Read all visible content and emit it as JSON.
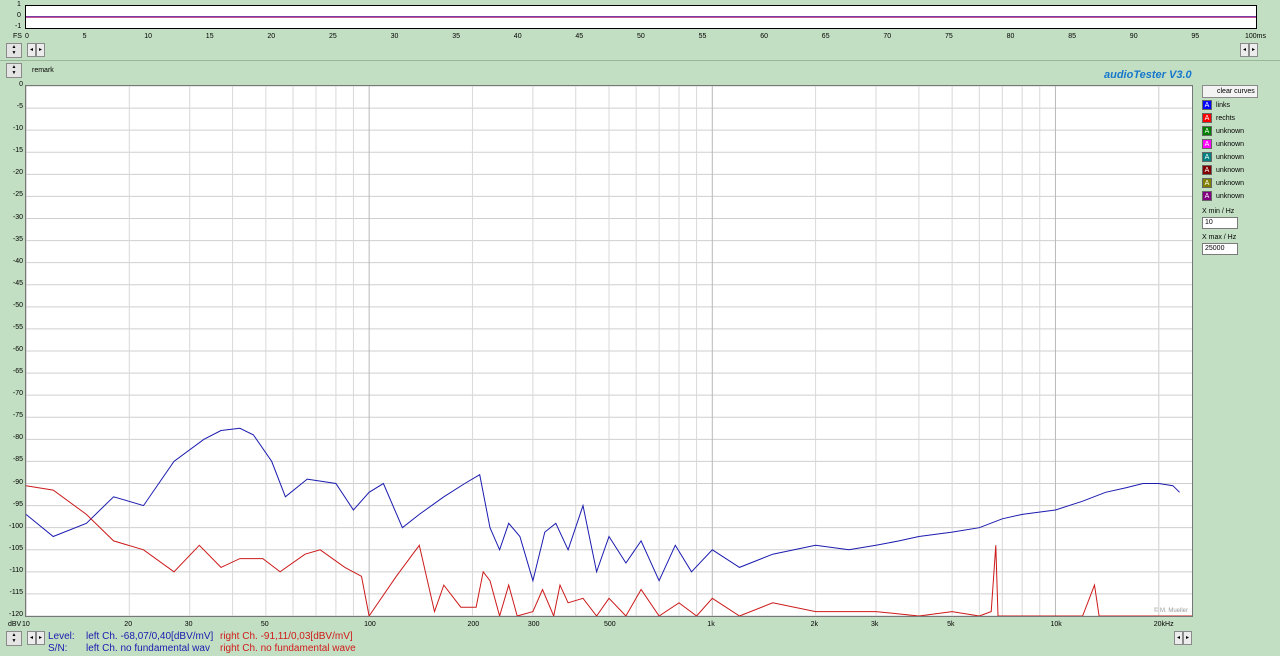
{
  "oscilloscope": {
    "y_labels": [
      "1",
      "0",
      "-1"
    ],
    "fs_label": "FS",
    "x_ticks": [
      "0",
      "5",
      "10",
      "15",
      "20",
      "25",
      "30",
      "35",
      "40",
      "45",
      "50",
      "55",
      "60",
      "65",
      "70",
      "75",
      "80",
      "85",
      "90",
      "95",
      "100ms"
    ]
  },
  "remark": {
    "label": "remark"
  },
  "brand": {
    "title": "audioTester  V3.0"
  },
  "copyright": "© M. Mueller",
  "spectrum": {
    "unit_label": "dBV",
    "y_ticks": [
      "0",
      "-5",
      "-10",
      "-15",
      "-20",
      "-25",
      "-30",
      "-35",
      "-40",
      "-45",
      "-50",
      "-55",
      "-60",
      "-65",
      "-70",
      "-75",
      "-80",
      "-85",
      "-90",
      "-95",
      "-100",
      "-105",
      "-110",
      "-115",
      "-120"
    ],
    "x_tick_labels": [
      {
        "f": 10,
        "t": "10"
      },
      {
        "f": 20,
        "t": "20"
      },
      {
        "f": 30,
        "t": "30"
      },
      {
        "f": 50,
        "t": "50"
      },
      {
        "f": 100,
        "t": "100"
      },
      {
        "f": 200,
        "t": "200"
      },
      {
        "f": 300,
        "t": "300"
      },
      {
        "f": 500,
        "t": "500"
      },
      {
        "f": 1000,
        "t": "1k"
      },
      {
        "f": 2000,
        "t": "2k"
      },
      {
        "f": 3000,
        "t": "3k"
      },
      {
        "f": 5000,
        "t": "5k"
      },
      {
        "f": 10000,
        "t": "10k"
      },
      {
        "f": 20000,
        "t": "20kHz"
      }
    ]
  },
  "panel": {
    "clear_button": "clear curves",
    "channels": [
      {
        "label": "links",
        "color": "#0000ff"
      },
      {
        "label": "rechts",
        "color": "#ff0000"
      },
      {
        "label": "unknown",
        "color": "#008000"
      },
      {
        "label": "unknown",
        "color": "#ff00ff"
      },
      {
        "label": "unknown",
        "color": "#008080"
      },
      {
        "label": "unknown",
        "color": "#800000"
      },
      {
        "label": "unknown",
        "color": "#808000"
      },
      {
        "label": "unknown",
        "color": "#800080"
      }
    ],
    "xmin_label": "X min / Hz",
    "xmin_value": "10",
    "xmax_label": "X max / Hz",
    "xmax_value": "25000"
  },
  "status": {
    "level_label": "Level:",
    "level_left": "left Ch. -68,07/0,40[dBV/mV]",
    "level_right": "right Ch. -91,11/0,03[dBV/mV]",
    "sn_label": "S/N:",
    "sn_left": "left Ch.  no fundamental wav",
    "sn_right": "right Ch.  no fundamental wave"
  },
  "chart_data": {
    "type": "line",
    "xscale": "log",
    "xlim": [
      10,
      25000
    ],
    "ylim": [
      -120,
      0
    ],
    "grid": true,
    "series": [
      {
        "name": "links",
        "color": "#1b1bb0",
        "points": [
          [
            10,
            -97
          ],
          [
            12,
            -102
          ],
          [
            15,
            -99
          ],
          [
            18,
            -93
          ],
          [
            22,
            -95
          ],
          [
            27,
            -85
          ],
          [
            33,
            -80
          ],
          [
            37,
            -78
          ],
          [
            42,
            -77.5
          ],
          [
            46,
            -79
          ],
          [
            52,
            -85
          ],
          [
            57,
            -93
          ],
          [
            66,
            -89
          ],
          [
            80,
            -90
          ],
          [
            90,
            -96
          ],
          [
            100,
            -92
          ],
          [
            110,
            -90
          ],
          [
            125,
            -100
          ],
          [
            140,
            -97
          ],
          [
            165,
            -93
          ],
          [
            190,
            -90
          ],
          [
            210,
            -88
          ],
          [
            225,
            -100
          ],
          [
            240,
            -105
          ],
          [
            255,
            -99
          ],
          [
            275,
            -102
          ],
          [
            300,
            -112
          ],
          [
            325,
            -101
          ],
          [
            350,
            -99
          ],
          [
            380,
            -105
          ],
          [
            420,
            -95
          ],
          [
            460,
            -110
          ],
          [
            500,
            -102
          ],
          [
            560,
            -108
          ],
          [
            620,
            -103
          ],
          [
            700,
            -112
          ],
          [
            780,
            -104
          ],
          [
            870,
            -110
          ],
          [
            1000,
            -105
          ],
          [
            1200,
            -109
          ],
          [
            1500,
            -106
          ],
          [
            2000,
            -104
          ],
          [
            2500,
            -105
          ],
          [
            3000,
            -104
          ],
          [
            3500,
            -103
          ],
          [
            4000,
            -102
          ],
          [
            5000,
            -101
          ],
          [
            6000,
            -100
          ],
          [
            7000,
            -98
          ],
          [
            8000,
            -97
          ],
          [
            10000,
            -96
          ],
          [
            12000,
            -94
          ],
          [
            14000,
            -92
          ],
          [
            16000,
            -91
          ],
          [
            18000,
            -90
          ],
          [
            20000,
            -90
          ],
          [
            22000,
            -90.5
          ],
          [
            23000,
            -92
          ]
        ]
      },
      {
        "name": "rechts",
        "color": "#cc1a1a",
        "points": [
          [
            10,
            -90.5
          ],
          [
            12,
            -91.5
          ],
          [
            15,
            -97
          ],
          [
            18,
            -103
          ],
          [
            22,
            -105
          ],
          [
            27,
            -110
          ],
          [
            32,
            -104
          ],
          [
            37,
            -109
          ],
          [
            42,
            -107
          ],
          [
            49,
            -107
          ],
          [
            55,
            -110
          ],
          [
            65,
            -106
          ],
          [
            72,
            -105
          ],
          [
            85,
            -109
          ],
          [
            95,
            -111
          ],
          [
            100,
            -120
          ],
          [
            120,
            -111
          ],
          [
            140,
            -104
          ],
          [
            155,
            -119
          ],
          [
            165,
            -113
          ],
          [
            185,
            -118
          ],
          [
            205,
            -118
          ],
          [
            215,
            -110
          ],
          [
            225,
            -112
          ],
          [
            240,
            -120
          ],
          [
            255,
            -113
          ],
          [
            270,
            -120
          ],
          [
            300,
            -119
          ],
          [
            320,
            -114
          ],
          [
            345,
            -120
          ],
          [
            360,
            -113
          ],
          [
            380,
            -117
          ],
          [
            420,
            -116
          ],
          [
            460,
            -120
          ],
          [
            500,
            -116
          ],
          [
            560,
            -120
          ],
          [
            620,
            -114
          ],
          [
            700,
            -120
          ],
          [
            800,
            -117
          ],
          [
            900,
            -120
          ],
          [
            1000,
            -116
          ],
          [
            1200,
            -120
          ],
          [
            1500,
            -117
          ],
          [
            2000,
            -119
          ],
          [
            3000,
            -119
          ],
          [
            4000,
            -120
          ],
          [
            5000,
            -119
          ],
          [
            6000,
            -120
          ],
          [
            6500,
            -119
          ],
          [
            6700,
            -104
          ],
          [
            6800,
            -120
          ],
          [
            8000,
            -120
          ],
          [
            12000,
            -120
          ],
          [
            13000,
            -113
          ],
          [
            13400,
            -120
          ],
          [
            25000,
            -120
          ]
        ]
      }
    ]
  }
}
